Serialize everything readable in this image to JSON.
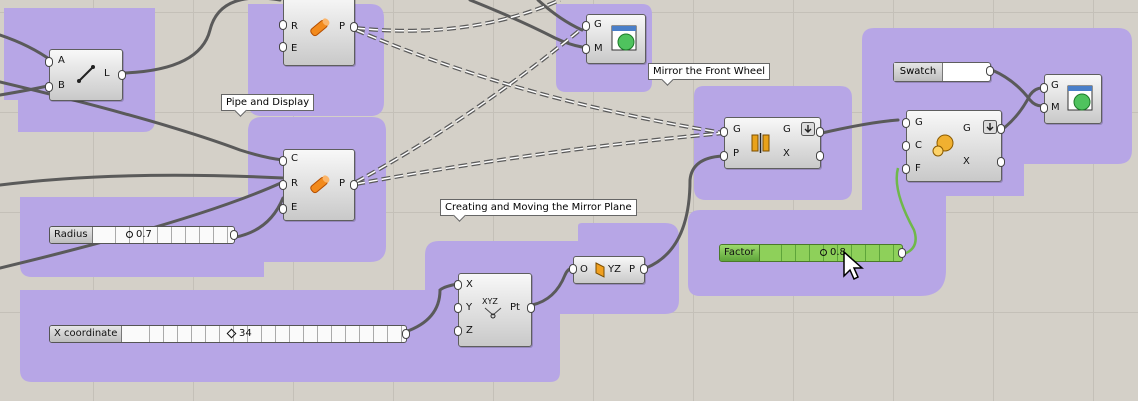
{
  "groups": {
    "line_group": {
      "color": "#b7a6e6"
    },
    "pipe_top_group": {
      "color": "#b7a6e6"
    },
    "pipe_display_group": {
      "color": "#b7a6e6"
    },
    "preview_top_group": {
      "color": "#b7a6e6"
    },
    "mirror_front_group": {
      "color": "#b7a6e6"
    },
    "mirror_plane_group": {
      "color": "#b7a6e6"
    },
    "right_group": {
      "color": "#b7a6e6"
    }
  },
  "balloons": {
    "pipe_display": "Pipe and Display",
    "mirror_front": "Mirror the Front Wheel",
    "mirror_plane": "Creating and Moving the Mirror Plane"
  },
  "line_comp": {
    "in": [
      "A",
      "B"
    ],
    "out": [
      "L"
    ],
    "icon": "line-icon"
  },
  "pipe_top": {
    "in": [
      "R",
      "E"
    ],
    "out": [
      "P"
    ],
    "icon": "pipe-icon"
  },
  "pipe_main": {
    "in": [
      "C",
      "R",
      "E"
    ],
    "out": [
      "P"
    ],
    "icon": "pipe-icon"
  },
  "preview_top": {
    "in": [
      "G",
      "M"
    ],
    "icon": "preview-icon"
  },
  "preview_right": {
    "in": [
      "G",
      "M"
    ],
    "icon": "preview-icon"
  },
  "mirror": {
    "in": [
      "G",
      "P"
    ],
    "out": [
      "G",
      "X"
    ],
    "icon": "mirror-icon"
  },
  "construct_point": {
    "in": [
      "X",
      "Y",
      "Z"
    ],
    "out": [
      "Pt"
    ],
    "icon_text": "XYZ"
  },
  "yz_plane": {
    "in": [
      "O"
    ],
    "out": [
      "P"
    ],
    "label": "YZ"
  },
  "scale": {
    "in": [
      "G",
      "C",
      "F"
    ],
    "out": [
      "G",
      "X"
    ],
    "icon": "scale-icon"
  },
  "sliders": {
    "radius": {
      "label": "Radius",
      "value": "0.7"
    },
    "x_coordinate": {
      "label": "X coordinate",
      "value": "34"
    },
    "factor": {
      "label": "Factor",
      "value": "0.8"
    }
  },
  "swatch": {
    "label": "Swatch",
    "color": "#ffffff"
  },
  "colors": {
    "wire": "#5a5a5a",
    "group": "#b7a6e6",
    "factor_green": "#8ed05a",
    "canvas": "#d4d0c8"
  }
}
